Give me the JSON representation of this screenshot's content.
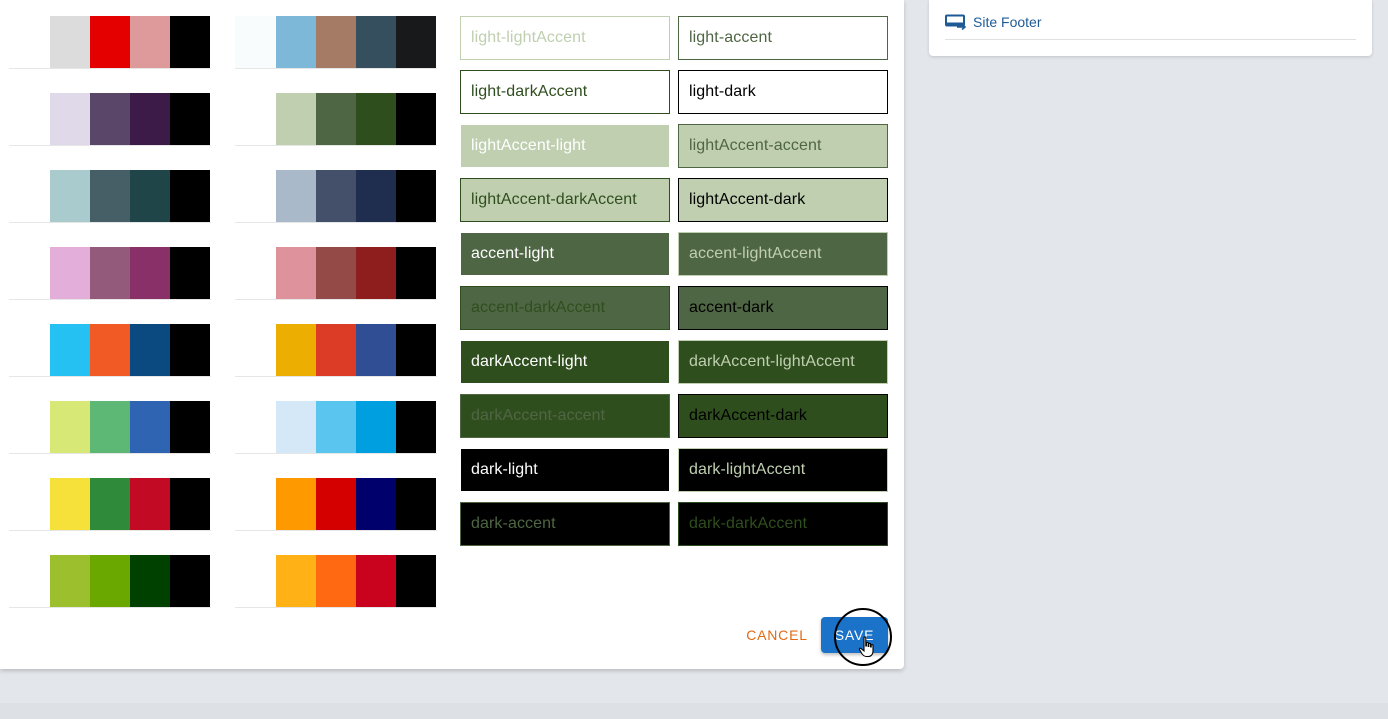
{
  "colors": {
    "light": "#ffffff",
    "lightAccent": "#bfcfb0",
    "accent": "#4f6644",
    "darkAccent": "#2f4e1e",
    "dark": "#000000",
    "save": "#1a73c8",
    "cancel": "#e06b16",
    "link": "#1e5b96"
  },
  "site_footer": {
    "label": "Site Footer",
    "icon": "footer-layout-icon"
  },
  "palettes": {
    "left": [
      [
        "#ffffff",
        "#dcdcdc",
        "#e50000",
        "#de9a9b",
        "#000000"
      ],
      [
        "#ffffff",
        "#e0d9ea",
        "#5a4668",
        "#3d1b48",
        "#000000"
      ],
      [
        "#ffffff",
        "#a9cbcd",
        "#465f67",
        "#1f4549",
        "#000000"
      ],
      [
        "#ffffff",
        "#e4aedb",
        "#935a7c",
        "#893069",
        "#000000"
      ],
      [
        "#ffffff",
        "#25c1f2",
        "#f15a24",
        "#0a4a80",
        "#000000"
      ],
      [
        "#ffffff",
        "#d8e876",
        "#5cb874",
        "#2f64b3",
        "#000000"
      ],
      [
        "#ffffff",
        "#f5e13a",
        "#2f8a3a",
        "#c30a24",
        "#000000"
      ],
      [
        "#ffffff",
        "#9cbf2e",
        "#6aa800",
        "#004100",
        "#000000"
      ]
    ],
    "right": [
      [
        "#f9fcfd",
        "#7db8d8",
        "#a67b65",
        "#354f5f",
        "#18191b"
      ],
      [
        "#ffffff",
        "#bfcfb0",
        "#4f6644",
        "#2f4e1e",
        "#000000"
      ],
      [
        "#ffffff",
        "#aab9c9",
        "#444f69",
        "#1f2e4f",
        "#000000"
      ],
      [
        "#ffffff",
        "#de939c",
        "#944b47",
        "#8e1e1e",
        "#000000"
      ],
      [
        "#ffffff",
        "#ecae00",
        "#dc3b26",
        "#2f4e94",
        "#000000"
      ],
      [
        "#ffffff",
        "#d4e8f7",
        "#5ac6ef",
        "#00a0e0",
        "#000000"
      ],
      [
        "#ffffff",
        "#ff9900",
        "#d40000",
        "#00006d",
        "#000000"
      ],
      [
        "#ffffff",
        "#ffb116",
        "#ff6911",
        "#c9021e",
        "#000000"
      ]
    ]
  },
  "combos": [
    {
      "label": "light-lightAccent",
      "bg": "#ffffff",
      "fg": "#bfcfb0",
      "border": "#bfcfb0"
    },
    {
      "label": "light-accent",
      "bg": "#ffffff",
      "fg": "#4f6644",
      "border": "#4f6644"
    },
    {
      "label": "light-darkAccent",
      "bg": "#ffffff",
      "fg": "#2f4e1e",
      "border": "#2f4e1e"
    },
    {
      "label": "light-dark",
      "bg": "#ffffff",
      "fg": "#000000",
      "border": "#000000"
    },
    {
      "label": "lightAccent-light",
      "bg": "#bfcfb0",
      "fg": "#ffffff",
      "border": "#ffffff"
    },
    {
      "label": "lightAccent-accent",
      "bg": "#bfcfb0",
      "fg": "#4f6644",
      "border": "#4f6644"
    },
    {
      "label": "lightAccent-darkAccent",
      "bg": "#bfcfb0",
      "fg": "#2f4e1e",
      "border": "#2f4e1e"
    },
    {
      "label": "lightAccent-dark",
      "bg": "#bfcfb0",
      "fg": "#000000",
      "border": "#000000"
    },
    {
      "label": "accent-light",
      "bg": "#4f6644",
      "fg": "#ffffff",
      "border": "#ffffff"
    },
    {
      "label": "accent-lightAccent",
      "bg": "#4f6644",
      "fg": "#bfcfb0",
      "border": "#bfcfb0"
    },
    {
      "label": "accent-darkAccent",
      "bg": "#4f6644",
      "fg": "#2f4e1e",
      "border": "#2f4e1e"
    },
    {
      "label": "accent-dark",
      "bg": "#4f6644",
      "fg": "#000000",
      "border": "#000000"
    },
    {
      "label": "darkAccent-light",
      "bg": "#2f4e1e",
      "fg": "#ffffff",
      "border": "#ffffff"
    },
    {
      "label": "darkAccent-lightAccent",
      "bg": "#2f4e1e",
      "fg": "#bfcfb0",
      "border": "#bfcfb0"
    },
    {
      "label": "darkAccent-accent",
      "bg": "#2f4e1e",
      "fg": "#4f6644",
      "border": "#4f6644"
    },
    {
      "label": "darkAccent-dark",
      "bg": "#2f4e1e",
      "fg": "#000000",
      "border": "#000000"
    },
    {
      "label": "dark-light",
      "bg": "#000000",
      "fg": "#ffffff",
      "border": "#ffffff"
    },
    {
      "label": "dark-lightAccent",
      "bg": "#000000",
      "fg": "#bfcfb0",
      "border": "#bfcfb0"
    },
    {
      "label": "dark-accent",
      "bg": "#000000",
      "fg": "#4f6644",
      "border": "#4f6644"
    },
    {
      "label": "dark-darkAccent",
      "bg": "#000000",
      "fg": "#2f4e1e",
      "border": "#2f4e1e"
    }
  ],
  "actions": {
    "cancel": "CANCEL",
    "save": "SAVE"
  }
}
